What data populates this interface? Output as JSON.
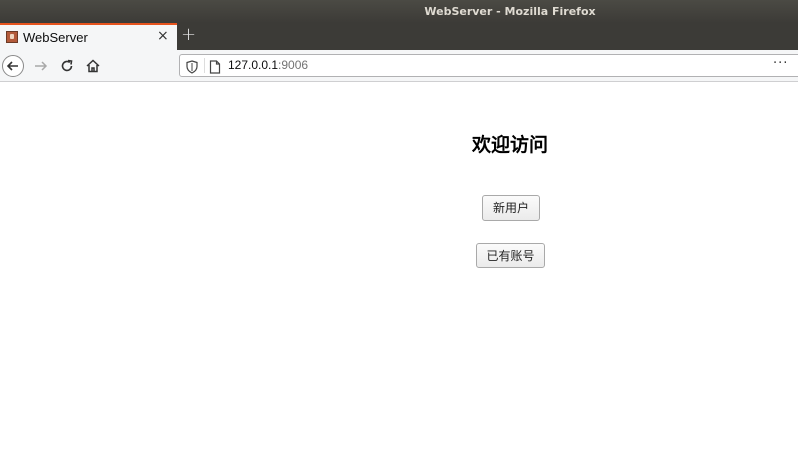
{
  "window": {
    "title": "WebServer - Mozilla Firefox"
  },
  "tabs": [
    {
      "label": "WebServer",
      "close_glyph": "×"
    }
  ],
  "new_tab_glyph": "+",
  "navbar": {
    "url_host": "127.0.0.1",
    "url_port": ":9006",
    "more_glyph": "···"
  },
  "page": {
    "heading": "欢迎访问",
    "new_user_label": "新用户",
    "existing_account_label": "已有账号"
  },
  "icons": {
    "back": "back-arrow-icon",
    "forward": "forward-arrow-icon",
    "reload": "reload-icon",
    "home": "home-icon",
    "tracking": "shield-icon",
    "page": "page-icon"
  }
}
